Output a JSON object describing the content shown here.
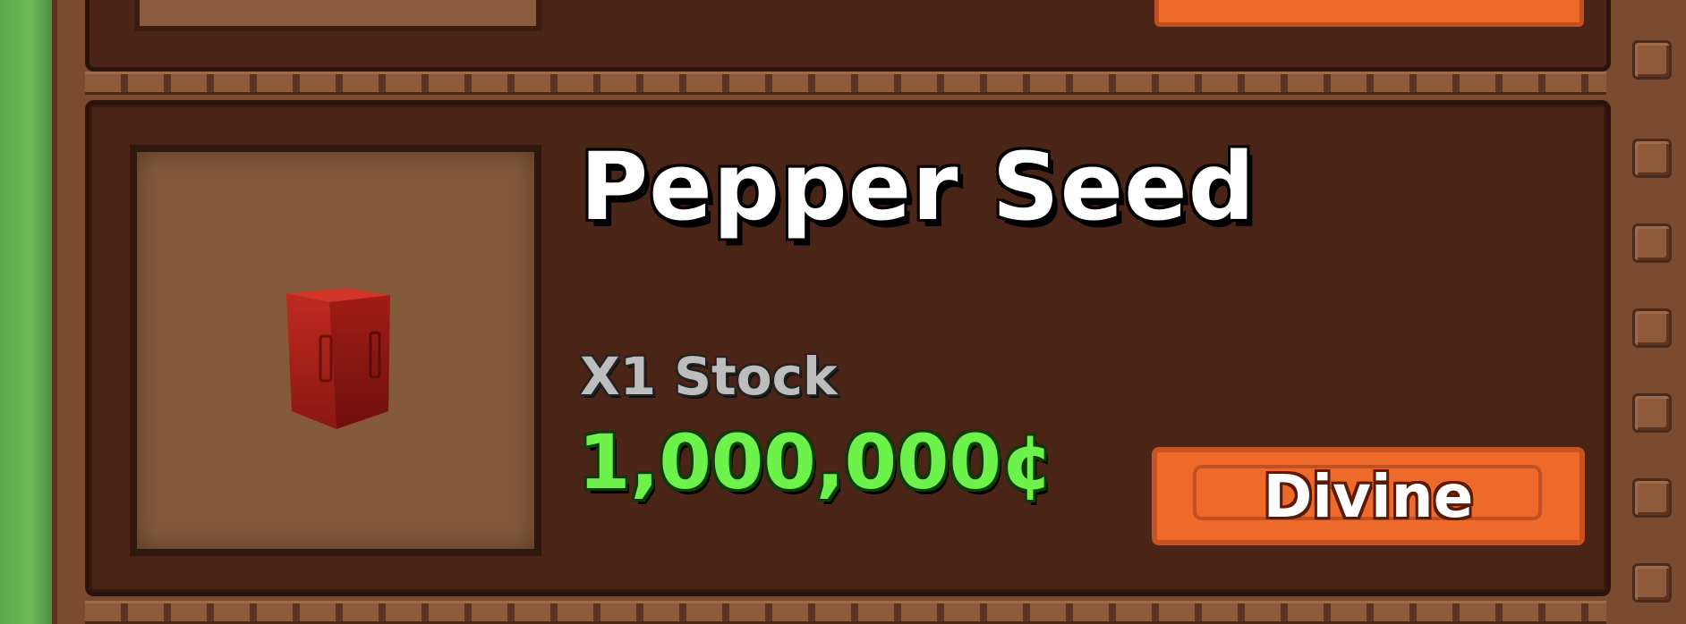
{
  "shop": {
    "item": {
      "name": "Pepper Seed",
      "stock": "X1 Stock",
      "price": "1,000,000¢",
      "rarity": "Divine",
      "icon": "pepper-seed-pack-icon"
    }
  },
  "colors": {
    "card_background": "#4a2416",
    "frame": "#7b4b30",
    "price_text": "#6cf24a",
    "rarity_button": "#ee6a2a",
    "stock_text": "#bdbdbd",
    "title_text": "#ffffff",
    "seed_pack": "#b2271e"
  }
}
